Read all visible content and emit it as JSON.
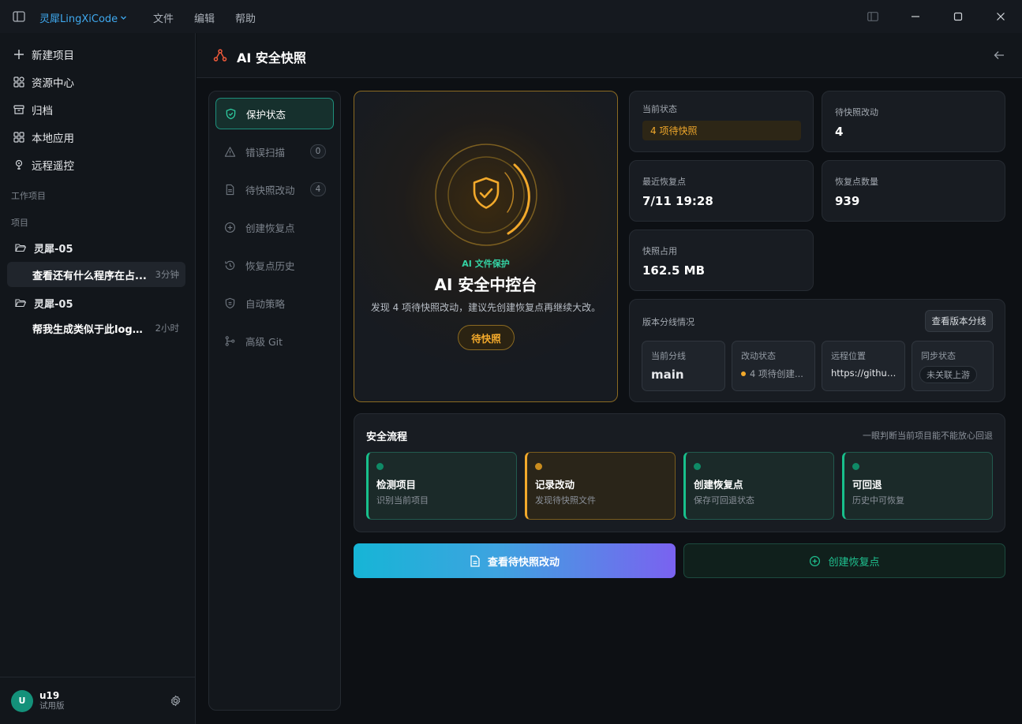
{
  "titlebar": {
    "brand": "灵犀LingXiCode",
    "menus": [
      "文件",
      "编辑",
      "帮助"
    ]
  },
  "sidebar": {
    "nav": [
      {
        "label": "新建项目",
        "icon": "plus-icon"
      },
      {
        "label": "资源中心",
        "icon": "grid-icon"
      },
      {
        "label": "归档",
        "icon": "archive-icon"
      },
      {
        "label": "本地应用",
        "icon": "apps-icon"
      },
      {
        "label": "远程遥控",
        "icon": "remote-icon"
      }
    ],
    "section_work": "工作项目",
    "section_projects": "项目",
    "projects": [
      {
        "name": "灵犀-05",
        "chat": "查看还有什么程序在占...",
        "time": "3分钟"
      },
      {
        "name": "灵犀-05",
        "chat": "帮我生成类似于此logo...",
        "time": "2小时"
      }
    ],
    "user": {
      "avatar": "U",
      "name": "u19",
      "plan": "试用版"
    }
  },
  "header": {
    "title": "AI 安全快照"
  },
  "tabs": [
    {
      "label": "保护状态",
      "icon": "shield-check-icon",
      "badge": null
    },
    {
      "label": "错误扫描",
      "icon": "warning-icon",
      "badge": "0"
    },
    {
      "label": "待快照改动",
      "icon": "file-icon",
      "badge": "4"
    },
    {
      "label": "创建恢复点",
      "icon": "plus-circle-icon",
      "badge": null
    },
    {
      "label": "恢复点历史",
      "icon": "history-icon",
      "badge": null
    },
    {
      "label": "自动策略",
      "icon": "shield-icon",
      "badge": null
    },
    {
      "label": "高级 Git",
      "icon": "git-icon",
      "badge": null
    }
  ],
  "hero": {
    "kicker": "AI 文件保护",
    "title": "AI 安全中控台",
    "desc": "发现 4 项待快照改动，建议先创建恢复点再继续大改。",
    "button": "待快照"
  },
  "stats": {
    "status_label": "当前状态",
    "status_value": "4 项待快照",
    "pending_label": "待快照改动",
    "pending_value": "4",
    "recent_label": "最近恢复点",
    "recent_value": "7/11 19:28",
    "count_label": "恢复点数量",
    "count_value": "939",
    "usage_label": "快照占用",
    "usage_value": "162.5 MB"
  },
  "branch": {
    "title": "版本分线情况",
    "button": "查看版本分线",
    "items": [
      {
        "label": "当前分线",
        "value": "main"
      },
      {
        "label": "改动状态",
        "value": "4 项待创建..."
      },
      {
        "label": "远程位置",
        "value": "https://github..."
      },
      {
        "label": "同步状态",
        "value": "未关联上游"
      }
    ]
  },
  "flow": {
    "title": "安全流程",
    "hint": "一眼判断当前项目能不能放心回退",
    "steps": [
      {
        "title": "检测项目",
        "desc": "识别当前项目",
        "state": "done"
      },
      {
        "title": "记录改动",
        "desc": "发现待快照文件",
        "state": "warn"
      },
      {
        "title": "创建恢复点",
        "desc": "保存可回退状态",
        "state": "done"
      },
      {
        "title": "可回退",
        "desc": "历史中可恢复",
        "state": "done"
      }
    ]
  },
  "actions": {
    "primary": "查看待快照改动",
    "secondary": "创建恢复点"
  },
  "colors": {
    "accent_teal": "#1fc190",
    "accent_amber": "#f2a92b",
    "brand_blue": "#3fa9ef"
  }
}
